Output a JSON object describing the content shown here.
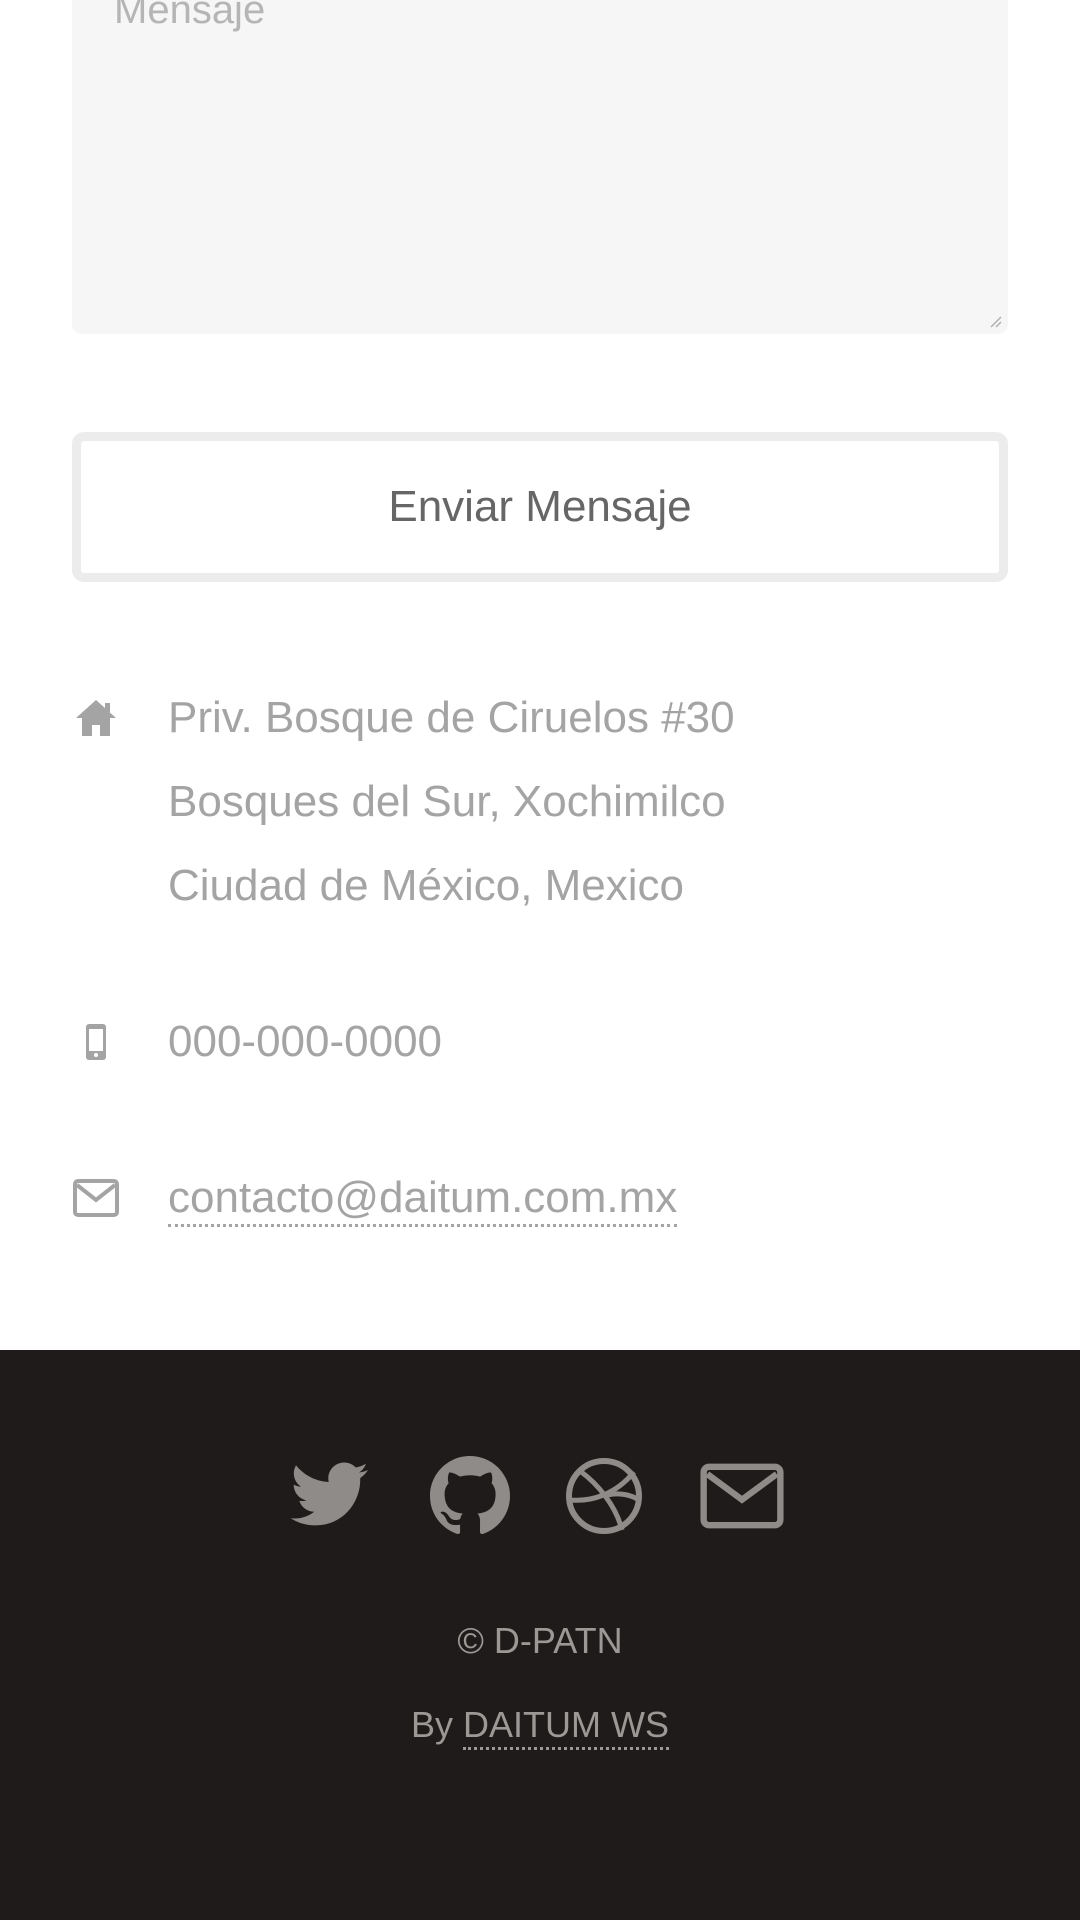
{
  "form": {
    "message_placeholder": "Mensaje",
    "send_label": "Enviar Mensaje"
  },
  "contact": {
    "address_lines": [
      "Priv. Bosque de Ciruelos #30",
      "Bosques del Sur, Xochimilco",
      "Ciudad de México, Mexico"
    ],
    "phone": "000-000-0000",
    "email": "contacto@daitum.com.mx",
    "icons": [
      "home-icon",
      "mobile-phone-icon",
      "envelope-outline-icon"
    ]
  },
  "footer": {
    "social_icons": [
      "twitter-icon",
      "github-icon",
      "dribbble-icon",
      "envelope-icon"
    ],
    "copyright": "© D-PATN",
    "by_prefix": "By",
    "by_link": "DAITUM WS"
  },
  "colors": {
    "text_muted": "#a4a4a4",
    "button_text": "#666666",
    "field_bg": "#f6f6f6",
    "button_border": "#ececec",
    "footer_bg": "#1f1b1a",
    "footer_icon": "#8f8b89",
    "footer_text": "#9c9896"
  }
}
